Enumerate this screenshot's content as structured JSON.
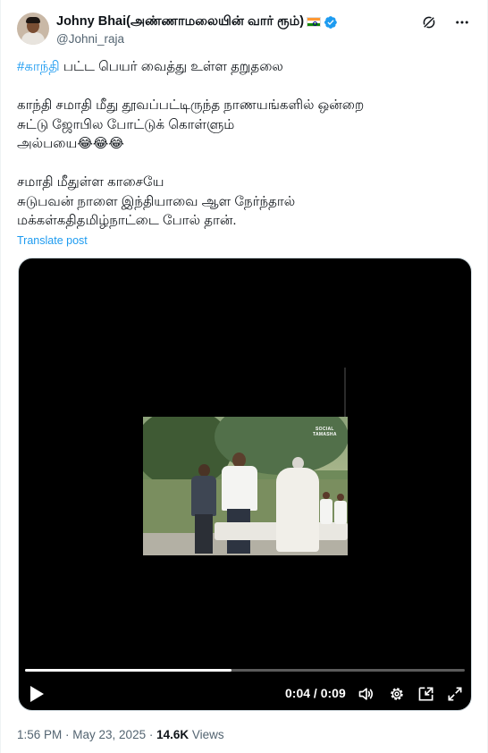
{
  "author": {
    "display_name": "Johny Bhai(அண்ணாமலையின் வார் ரூம்)",
    "handle": "@Johni_raja",
    "verified": true
  },
  "tweet": {
    "hashtag": "#காந்தி",
    "line1_rest": " பட்ட பெயர் வைத்து உள்ள தறுதலை",
    "line2": "காந்தி சமாதி மீது தூவப்பட்டிருந்த நாணயங்களில் ஒன்றை",
    "line3": "சுட்டு ஜோபில போட்டுக் கொள்ளும்",
    "line4": "அல்பயை😂😂😂",
    "line5": "சமாதி மீதுள்ள காசையே",
    "line6": "சுடுபவன் நாளை இந்தியாவை ஆள நேர்ந்தால்",
    "line7": "மக்கள்கதிதமிழ்நாட்டை போல் தான்."
  },
  "translate_label": "Translate post",
  "video": {
    "current_time": "0:04",
    "duration": "0:09",
    "time_separator": " / ",
    "progress_fraction": 0.47,
    "watermark_line1": "SOCIAL",
    "watermark_line2": "TAMASHA"
  },
  "meta": {
    "time": "1:56 PM",
    "separator": " · ",
    "date": "May 23, 2025",
    "views_count": "14.6K",
    "views_label": " Views"
  },
  "icons": [
    "grok-icon",
    "more-icon",
    "verified-badge-icon",
    "play-icon",
    "volume-icon",
    "settings-icon",
    "pip-icon",
    "fullscreen-icon"
  ],
  "colors": {
    "accent": "#1d9bf0",
    "text": "#0f1419",
    "secondary": "#536471"
  }
}
